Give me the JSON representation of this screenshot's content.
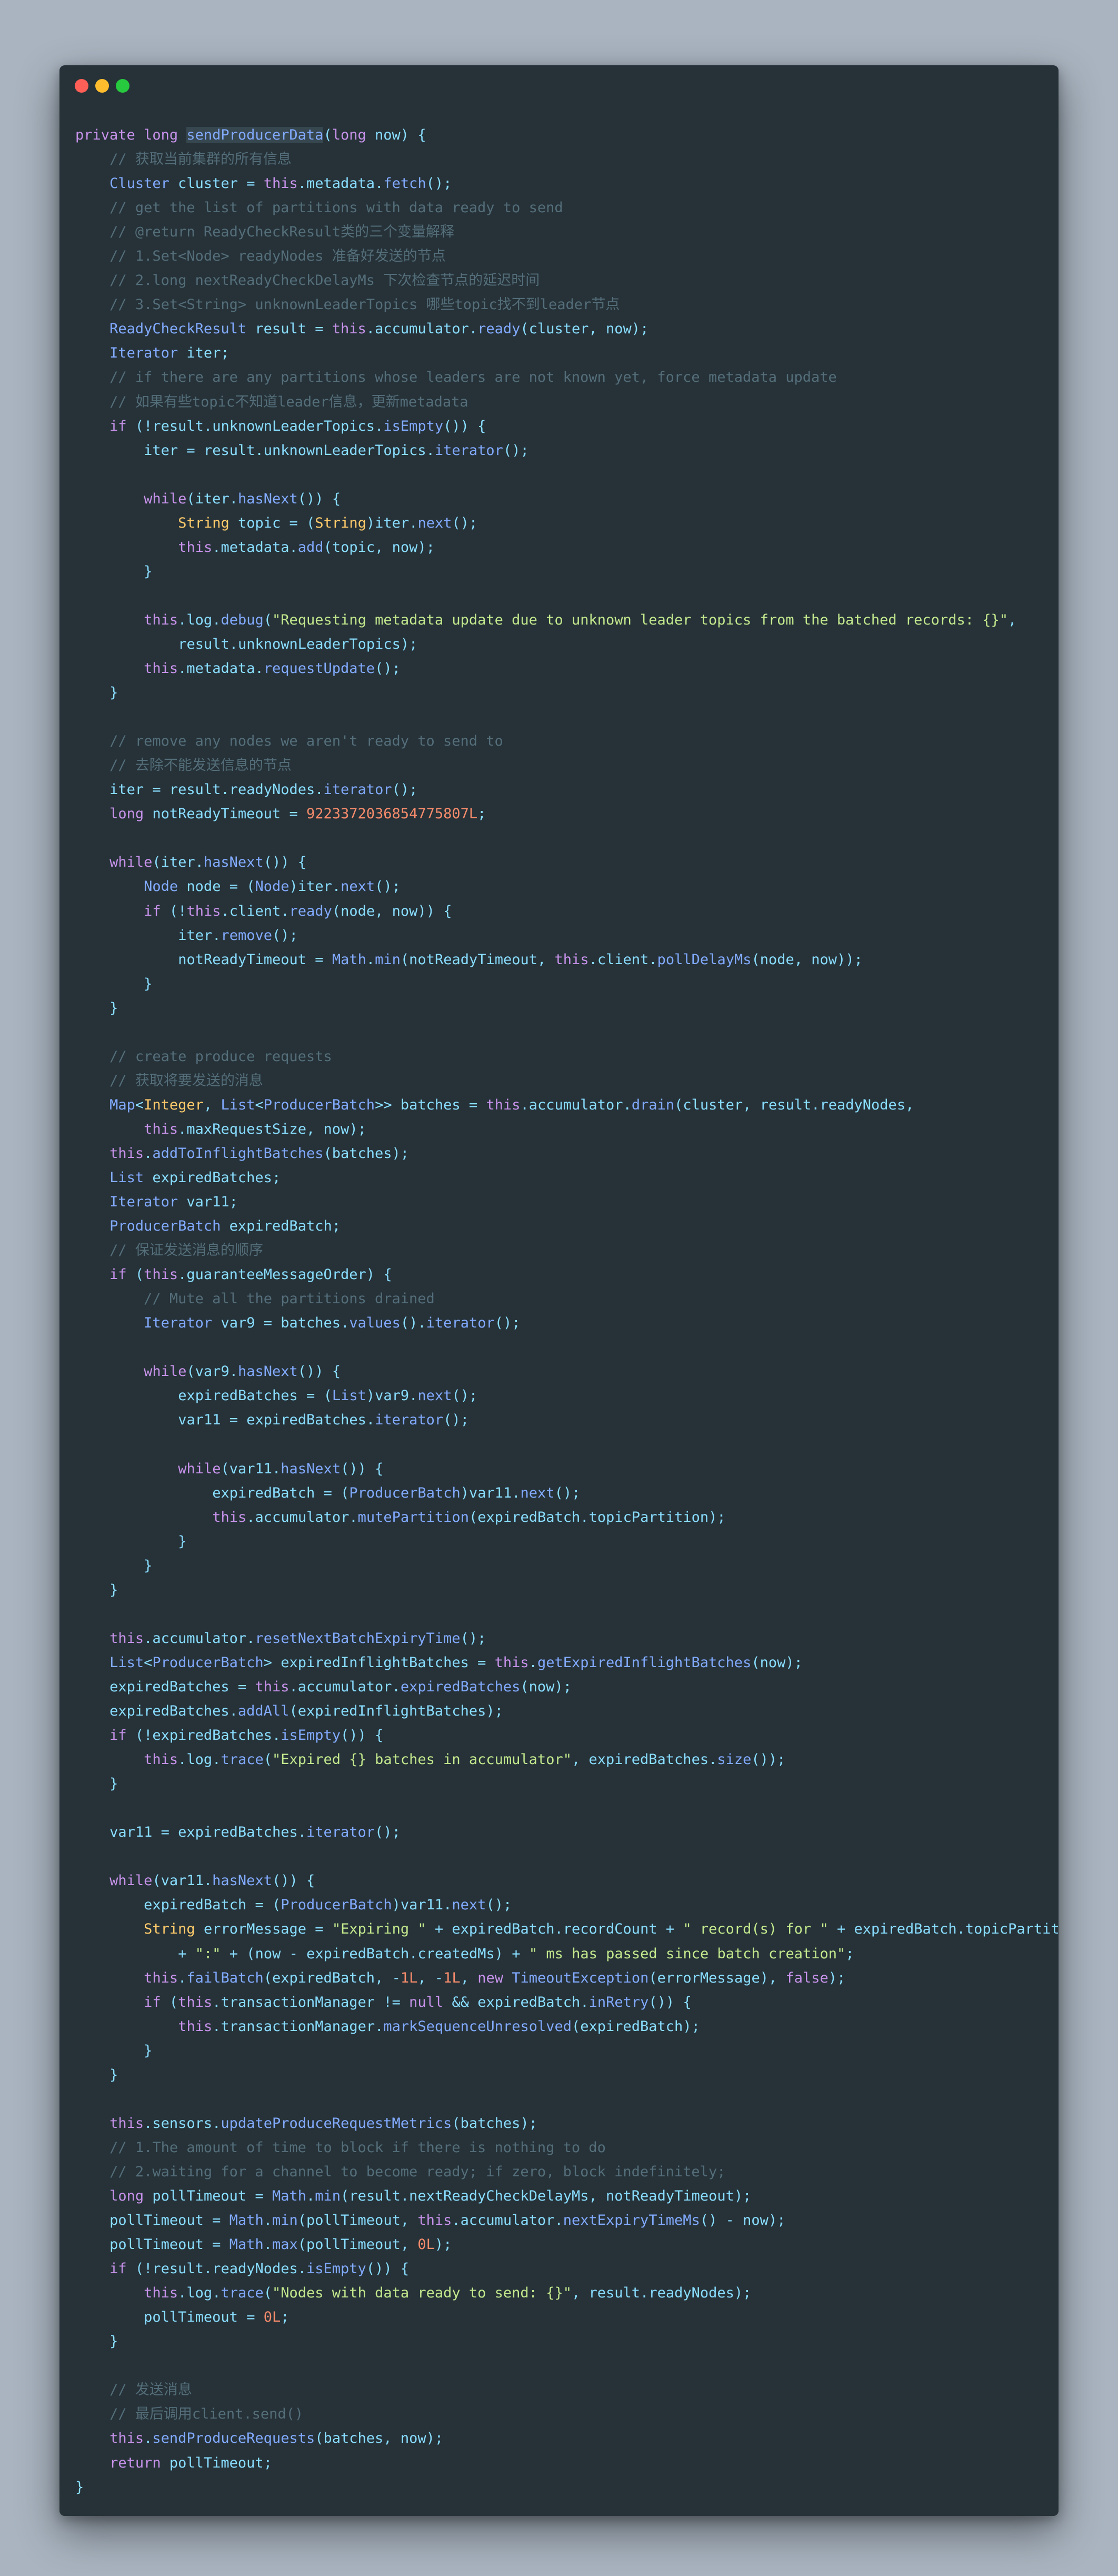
{
  "window": {
    "controls": [
      "close",
      "minimize",
      "maximize"
    ],
    "colors": {
      "background": "#263238",
      "page_background": "#a9b4c0",
      "close": "#ff5f56",
      "minimize": "#ffbd2e",
      "maximize": "#27c93f"
    }
  },
  "editor": {
    "language": "java",
    "highlighted_token": "sendProducerData",
    "syntax_colors": {
      "keyword": "#c792ea",
      "type": "#ffcb6b",
      "function": "#82aaff",
      "string": "#c3e88d",
      "number": "#f78c6c",
      "comment": "#546e7a",
      "plain": "#89ddff"
    },
    "lines": [
      "private long sendProducerData(long now) {",
      "    // 获取当前集群的所有信息",
      "    Cluster cluster = this.metadata.fetch();",
      "    // get the list of partitions with data ready to send",
      "    // @return ReadyCheckResult类的三个变量解释",
      "    // 1.Set<Node> readyNodes 准备好发送的节点",
      "    // 2.long nextReadyCheckDelayMs 下次检查节点的延迟时间",
      "    // 3.Set<String> unknownLeaderTopics 哪些topic找不到leader节点",
      "    ReadyCheckResult result = this.accumulator.ready(cluster, now);",
      "    Iterator iter;",
      "    // if there are any partitions whose leaders are not known yet, force metadata update",
      "    // 如果有些topic不知道leader信息，更新metadata",
      "    if (!result.unknownLeaderTopics.isEmpty()) {",
      "        iter = result.unknownLeaderTopics.iterator();",
      "",
      "        while(iter.hasNext()) {",
      "            String topic = (String)iter.next();",
      "            this.metadata.add(topic, now);",
      "        }",
      "",
      "        this.log.debug(\"Requesting metadata update due to unknown leader topics from the batched records: {}\",",
      "            result.unknownLeaderTopics);",
      "        this.metadata.requestUpdate();",
      "    }",
      "",
      "    // remove any nodes we aren't ready to send to",
      "    // 去除不能发送信息的节点",
      "    iter = result.readyNodes.iterator();",
      "    long notReadyTimeout = 9223372036854775807L;",
      "",
      "    while(iter.hasNext()) {",
      "        Node node = (Node)iter.next();",
      "        if (!this.client.ready(node, now)) {",
      "            iter.remove();",
      "            notReadyTimeout = Math.min(notReadyTimeout, this.client.pollDelayMs(node, now));",
      "        }",
      "    }",
      "",
      "    // create produce requests",
      "    // 获取将要发送的消息",
      "    Map<Integer, List<ProducerBatch>> batches = this.accumulator.drain(cluster, result.readyNodes,",
      "        this.maxRequestSize, now);",
      "    this.addToInflightBatches(batches);",
      "    List expiredBatches;",
      "    Iterator var11;",
      "    ProducerBatch expiredBatch;",
      "    // 保证发送消息的顺序",
      "    if (this.guaranteeMessageOrder) {",
      "        // Mute all the partitions drained",
      "        Iterator var9 = batches.values().iterator();",
      "",
      "        while(var9.hasNext()) {",
      "            expiredBatches = (List)var9.next();",
      "            var11 = expiredBatches.iterator();",
      "",
      "            while(var11.hasNext()) {",
      "                expiredBatch = (ProducerBatch)var11.next();",
      "                this.accumulator.mutePartition(expiredBatch.topicPartition);",
      "            }",
      "        }",
      "    }",
      "",
      "    this.accumulator.resetNextBatchExpiryTime();",
      "    List<ProducerBatch> expiredInflightBatches = this.getExpiredInflightBatches(now);",
      "    expiredBatches = this.accumulator.expiredBatches(now);",
      "    expiredBatches.addAll(expiredInflightBatches);",
      "    if (!expiredBatches.isEmpty()) {",
      "        this.log.trace(\"Expired {} batches in accumulator\", expiredBatches.size());",
      "    }",
      "",
      "    var11 = expiredBatches.iterator();",
      "",
      "    while(var11.hasNext()) {",
      "        expiredBatch = (ProducerBatch)var11.next();",
      "        String errorMessage = \"Expiring \" + expiredBatch.recordCount + \" record(s) for \" + expiredBatch.topicPartition",
      "            + \":\" + (now - expiredBatch.createdMs) + \" ms has passed since batch creation\";",
      "        this.failBatch(expiredBatch, -1L, -1L, new TimeoutException(errorMessage), false);",
      "        if (this.transactionManager != null && expiredBatch.inRetry()) {",
      "            this.transactionManager.markSequenceUnresolved(expiredBatch);",
      "        }",
      "    }",
      "",
      "    this.sensors.updateProduceRequestMetrics(batches);",
      "    // 1.The amount of time to block if there is nothing to do",
      "    // 2.waiting for a channel to become ready; if zero, block indefinitely;",
      "    long pollTimeout = Math.min(result.nextReadyCheckDelayMs, notReadyTimeout);",
      "    pollTimeout = Math.min(pollTimeout, this.accumulator.nextExpiryTimeMs() - now);",
      "    pollTimeout = Math.max(pollTimeout, 0L);",
      "    if (!result.readyNodes.isEmpty()) {",
      "        this.log.trace(\"Nodes with data ready to send: {}\", result.readyNodes);",
      "        pollTimeout = 0L;",
      "    }",
      "",
      "    // 发送消息",
      "    // 最后调用client.send()",
      "    this.sendProduceRequests(batches, now);",
      "    return pollTimeout;",
      "}"
    ]
  }
}
